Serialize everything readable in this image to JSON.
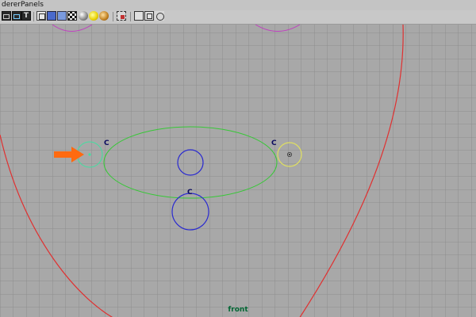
{
  "menu": {
    "items": [
      "derer",
      "Panels"
    ]
  },
  "toolbar": {
    "icons": [
      "camera-icon",
      "camera-attr-icon",
      "text-tool-icon",
      "wireframe-cube-icon",
      "smooth-shade-icon",
      "shaded-cube-icon",
      "texture-checker-icon",
      "sphere-shade-icon",
      "default-light-icon",
      "all-lights-icon",
      "selection-highlight-icon",
      "isolate-select-icon",
      "cube-view-icon",
      "duplicate-view-icon",
      "snapshot-icon"
    ]
  },
  "viewport": {
    "label": "front",
    "locator_labels": [
      "C",
      "C",
      "C"
    ]
  },
  "colors": {
    "background": "#a8a8a8",
    "grid": "#8e8e8e",
    "head_outline": "#e03030",
    "mouth_curve": "#36c836",
    "handle": "#2a2ad0",
    "eye_circle": "#c040c0",
    "left_locator": "#40e0a0",
    "right_locator": "#e0e060",
    "arrow": "#ff6a10"
  }
}
